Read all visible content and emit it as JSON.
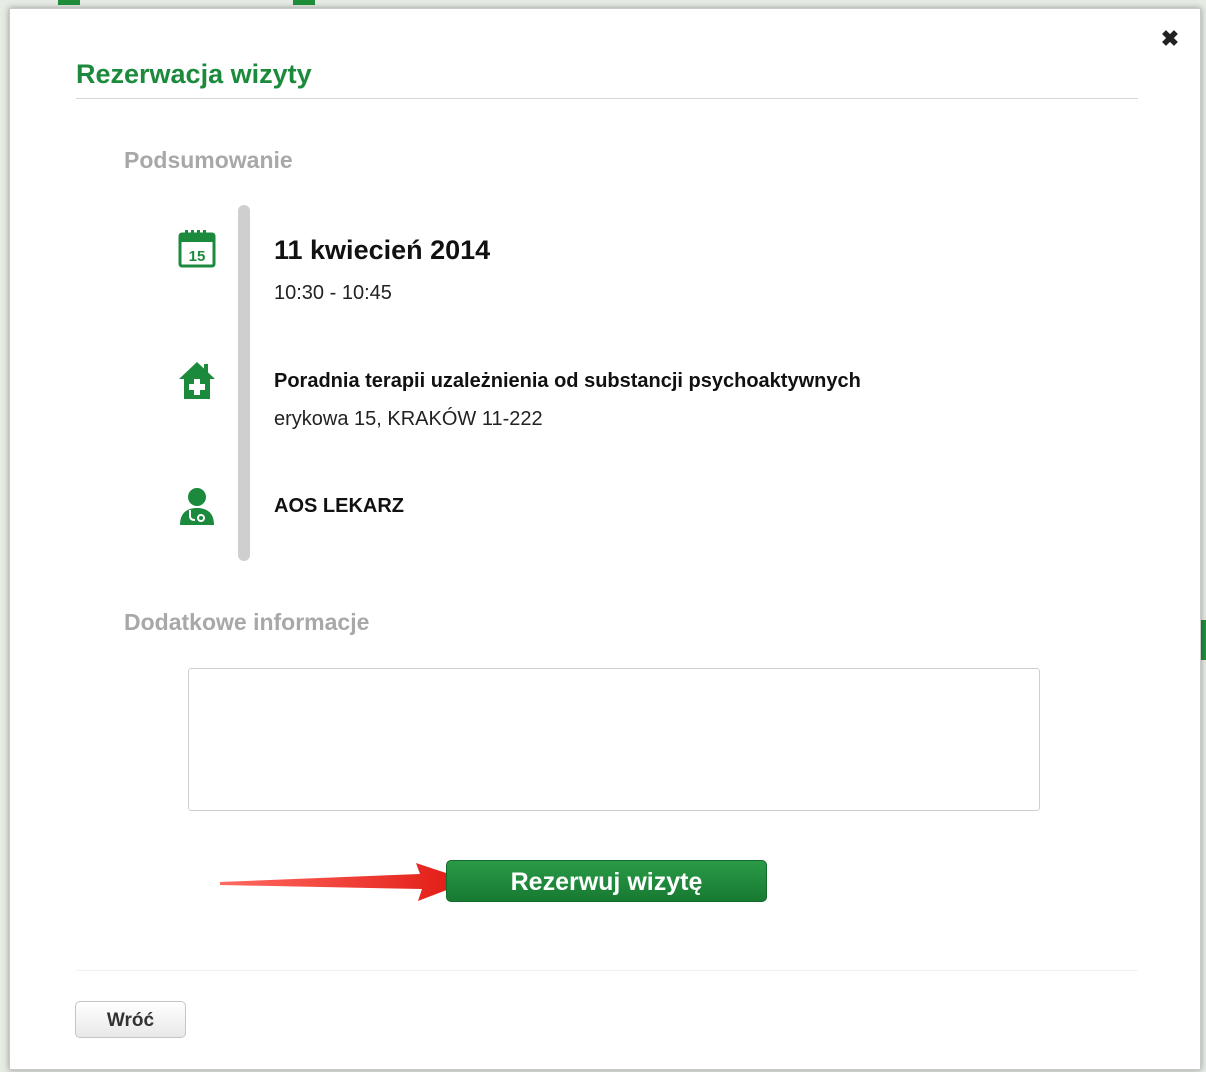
{
  "dialog": {
    "title": "Rezerwacja wizyty",
    "close_icon": "close-icon"
  },
  "summary": {
    "heading": "Podsumowanie",
    "date": "11 kwiecień 2014",
    "time": "10:30 - 10:45",
    "clinic_name": "Poradnia terapii uzależnienia od substancji psychoaktywnych",
    "clinic_address": "erykowa 15, KRAKÓW 11-222",
    "doctor": "AOS LEKARZ",
    "icons": [
      "calendar-icon",
      "clinic-house-icon",
      "doctor-icon"
    ]
  },
  "additional": {
    "heading": "Dodatkowe informacje",
    "value": "",
    "placeholder": ""
  },
  "actions": {
    "reserve_label": "Rezerwuj wizytę",
    "back_label": "Wróć"
  },
  "colors": {
    "accent_green": "#1c8a3c",
    "arrow_red": "#e8201c",
    "muted_heading": "#a8a8a8"
  }
}
